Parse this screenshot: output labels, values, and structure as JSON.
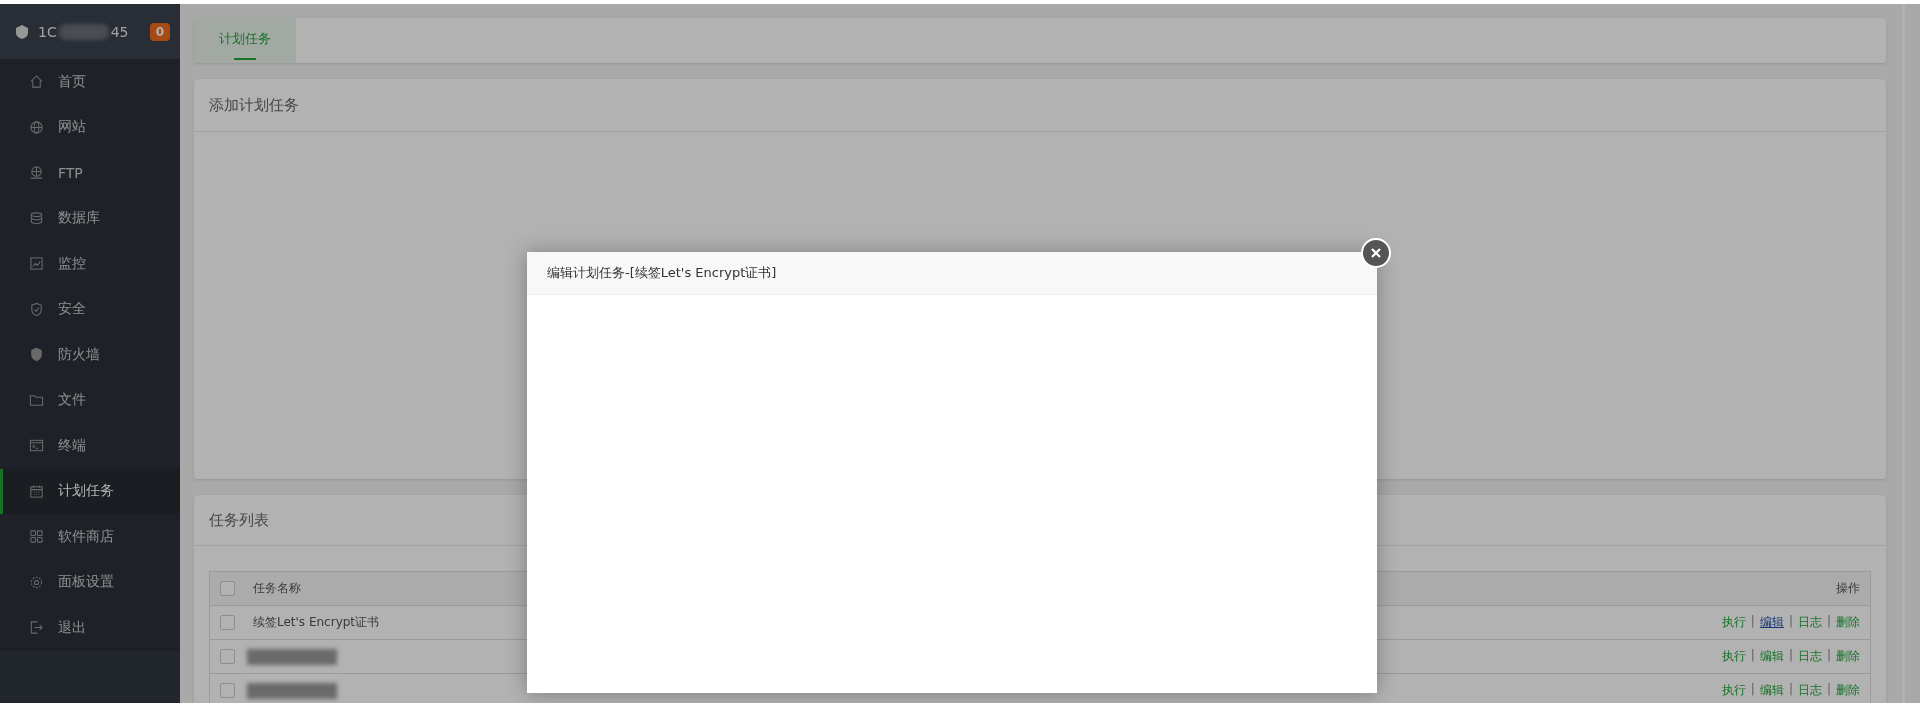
{
  "sidebar": {
    "host_start": "1C",
    "host_end": "45",
    "badge": "0",
    "items": [
      {
        "label": "首页",
        "kind": "home",
        "selected": false
      },
      {
        "label": "网站",
        "kind": "globe",
        "selected": false
      },
      {
        "label": "FTP",
        "kind": "ftp",
        "selected": false
      },
      {
        "label": "数据库",
        "kind": "database",
        "selected": false
      },
      {
        "label": "监控",
        "kind": "monitor",
        "selected": false
      },
      {
        "label": "安全",
        "kind": "shield",
        "selected": false
      },
      {
        "label": "防火墙",
        "kind": "firewall",
        "selected": false
      },
      {
        "label": "文件",
        "kind": "folder",
        "selected": false
      },
      {
        "label": "终端",
        "kind": "terminal",
        "selected": false
      },
      {
        "label": "计划任务",
        "kind": "calendar",
        "selected": true
      },
      {
        "label": "软件商店",
        "kind": "grid",
        "selected": false
      },
      {
        "label": "面板设置",
        "kind": "gear",
        "selected": false
      },
      {
        "label": "退出",
        "kind": "exit",
        "selected": false
      }
    ]
  },
  "tabs": [
    {
      "label": "计划任务",
      "selected": true
    }
  ],
  "add_panel": {
    "title": "添加计划任务"
  },
  "task_list": {
    "title": "任务列表",
    "separator": "|",
    "all_checked": false,
    "columns": [
      "任务名称",
      "操作"
    ],
    "rows": [
      {
        "name": "续签Let's Encrypt证书",
        "checked": false,
        "actions": [
          {
            "label": "执行",
            "hovered": false
          },
          {
            "label": "编辑",
            "hovered": true
          },
          {
            "label": "日志",
            "hovered": false
          },
          {
            "label": "删除",
            "hovered": false
          }
        ]
      },
      {
        "checked": false,
        "actions": [
          {
            "label": "执行",
            "hovered": false
          },
          {
            "label": "编辑",
            "hovered": false
          },
          {
            "label": "日志",
            "hovered": false
          },
          {
            "label": "删除",
            "hovered": false
          }
        ]
      },
      {
        "checked": false,
        "actions": [
          {
            "label": "执行",
            "hovered": false
          },
          {
            "label": "编辑",
            "hovered": false
          },
          {
            "label": "日志",
            "hovered": false
          },
          {
            "label": "删除",
            "hovered": false
          }
        ]
      }
    ]
  },
  "dialog": {
    "title": "编辑计划任务-[续签Let's Encrypt证书]"
  }
}
